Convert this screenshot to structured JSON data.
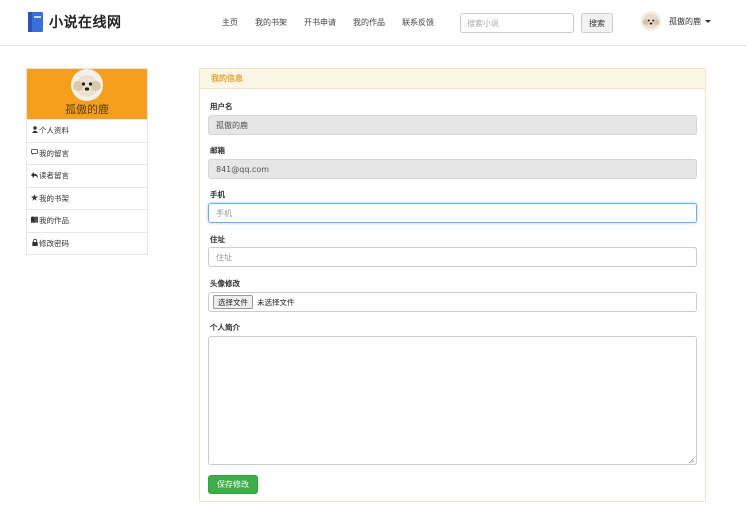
{
  "header": {
    "logo_text": "小说在线网",
    "nav": [
      "主页",
      "我的书架",
      "开书申请",
      "我的作品",
      "联系反馈"
    ],
    "search": {
      "placeholder": "搜索小说",
      "button_label": "搜索"
    },
    "user_name": "孤傲的鹿"
  },
  "sidebar": {
    "user_name": "孤傲的鹿",
    "items": [
      {
        "icon": "user-icon",
        "label": "个人资料"
      },
      {
        "icon": "comment-icon",
        "label": "我的留言"
      },
      {
        "icon": "reply-icon",
        "label": "读者留言"
      },
      {
        "icon": "star-icon",
        "label": "我的书架"
      },
      {
        "icon": "book-icon",
        "label": "我的作品"
      },
      {
        "icon": "lock-icon",
        "label": "修改密码"
      }
    ]
  },
  "panel": {
    "title": "我的信息",
    "username": {
      "label": "用户名",
      "value": "孤傲的鹿"
    },
    "email": {
      "label": "邮箱",
      "value": "841@qq.com"
    },
    "phone": {
      "label": "手机",
      "placeholder": "手机"
    },
    "address": {
      "label": "住址",
      "placeholder": "住址"
    },
    "avatar": {
      "label": "头像修改",
      "button_label": "选择文件",
      "status": "未选择文件"
    },
    "bio": {
      "label": "个人简介"
    },
    "save_label": "保存修改"
  },
  "colors": {
    "accent": "#f5a01d",
    "save": "#3fae49",
    "panel_title": "#e8a33a"
  }
}
